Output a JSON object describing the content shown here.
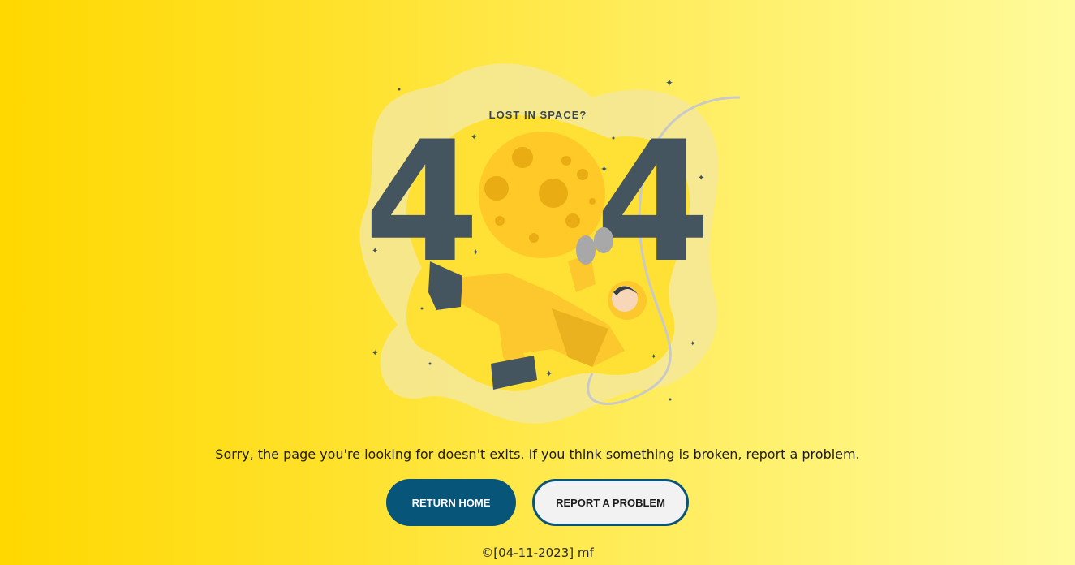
{
  "illustration": {
    "caption": "LOST IN SPACE?",
    "digits": [
      "4",
      "4"
    ]
  },
  "message": "Sorry, the page you're looking for doesn't exits. If you think something is broken, report a problem.",
  "buttons": {
    "home": "RETURN HOME",
    "report": "REPORT A PROBLEM"
  },
  "footer": "©[04-11-2023] mf",
  "colors": {
    "primary": "#08557a",
    "digit": "#455560",
    "moon": "#ffc928",
    "background_start": "#ffd800",
    "background_end": "#fffb9c"
  }
}
